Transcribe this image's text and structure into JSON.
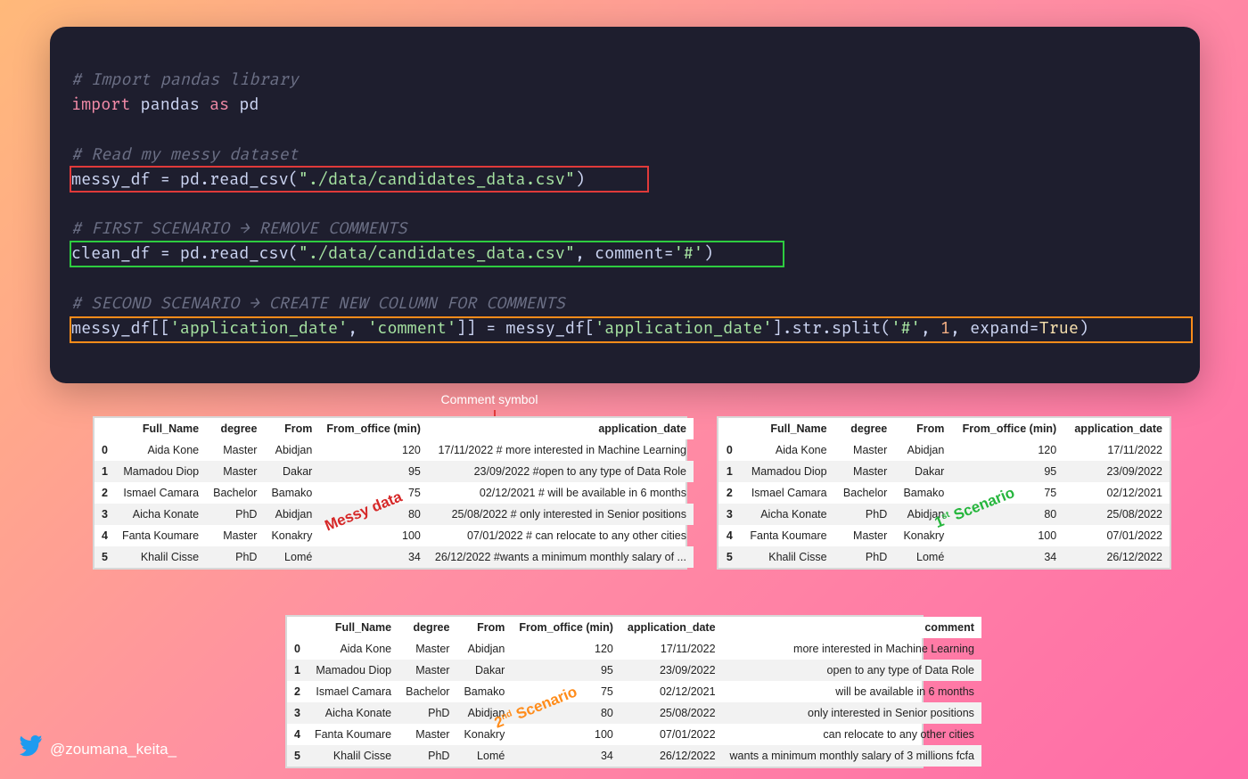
{
  "code": {
    "c1": "# Import pandas library",
    "c2": "# Read my messy dataset",
    "c3": "# FIRST SCENARIO → REMOVE COMMENTS",
    "c4": "# SECOND SCENARIO → CREATE NEW COLUMN FOR COMMENTS",
    "kw_import": "import",
    "pandas": "pandas",
    "kw_as": "as",
    "pd": "pd",
    "l3_a": "messy_df = pd.read_csv(",
    "l3_s": "\"./data/candidates_data.csv\"",
    "l3_b": ")",
    "l5_a": "clean_df = pd.read_csv(",
    "l5_s1": "\"./data/candidates_data.csv\"",
    "l5_m": ", comment=",
    "l5_s2": "'#'",
    "l5_b": ")",
    "l7_a": "messy_df[[",
    "l7_s1": "'application_date'",
    "l7_m1": ", ",
    "l7_s2": "'comment'",
    "l7_m2": "]] = messy_df[",
    "l7_s3": "'application_date'",
    "l7_m3": "].str.split(",
    "l7_s4": "'#'",
    "l7_m4": ", ",
    "l7_n": "1",
    "l7_m5": ", expand=",
    "l7_t": "True",
    "l7_b": ")"
  },
  "annot": {
    "comment_symbol": "Comment symbol",
    "messy": "Messy data",
    "s1a": "1",
    "s1b": "st",
    "s1c": " Scenario",
    "s2a": "2",
    "s2b": "nd",
    "s2c": " Scenario"
  },
  "tables": {
    "headers_messy": [
      "",
      "Full_Name",
      "degree",
      "From",
      "From_office (min)",
      "application_date"
    ],
    "headers_clean": [
      "",
      "Full_Name",
      "degree",
      "From",
      "From_office (min)",
      "application_date"
    ],
    "headers_split": [
      "",
      "Full_Name",
      "degree",
      "From",
      "From_office (min)",
      "application_date",
      "comment"
    ],
    "messy_rows": [
      [
        "0",
        "Aida Kone",
        "Master",
        "Abidjan",
        "120",
        "17/11/2022 # more interested in Machine Learning"
      ],
      [
        "1",
        "Mamadou Diop",
        "Master",
        "Dakar",
        "95",
        "23/09/2022 #open to any type of Data Role"
      ],
      [
        "2",
        "Ismael Camara",
        "Bachelor",
        "Bamako",
        "75",
        "02/12/2021 # will be available in 6 months"
      ],
      [
        "3",
        "Aicha Konate",
        "PhD",
        "Abidjan",
        "80",
        "25/08/2022 # only interested in Senior positions"
      ],
      [
        "4",
        "Fanta Koumare",
        "Master",
        "Konakry",
        "100",
        "07/01/2022 # can relocate to any other cities"
      ],
      [
        "5",
        "Khalil Cisse",
        "PhD",
        "Lomé",
        "34",
        "26/12/2022 #wants a minimum monthly salary of ..."
      ]
    ],
    "clean_rows": [
      [
        "0",
        "Aida Kone",
        "Master",
        "Abidjan",
        "120",
        "17/11/2022"
      ],
      [
        "1",
        "Mamadou Diop",
        "Master",
        "Dakar",
        "95",
        "23/09/2022"
      ],
      [
        "2",
        "Ismael Camara",
        "Bachelor",
        "Bamako",
        "75",
        "02/12/2021"
      ],
      [
        "3",
        "Aicha Konate",
        "PhD",
        "Abidjan",
        "80",
        "25/08/2022"
      ],
      [
        "4",
        "Fanta Koumare",
        "Master",
        "Konakry",
        "100",
        "07/01/2022"
      ],
      [
        "5",
        "Khalil Cisse",
        "PhD",
        "Lomé",
        "34",
        "26/12/2022"
      ]
    ],
    "split_rows": [
      [
        "0",
        "Aida Kone",
        "Master",
        "Abidjan",
        "120",
        "17/11/2022",
        "more interested in Machine Learning"
      ],
      [
        "1",
        "Mamadou Diop",
        "Master",
        "Dakar",
        "95",
        "23/09/2022",
        "open to any type of Data Role"
      ],
      [
        "2",
        "Ismael Camara",
        "Bachelor",
        "Bamako",
        "75",
        "02/12/2021",
        "will be available in 6 months"
      ],
      [
        "3",
        "Aicha Konate",
        "PhD",
        "Abidjan",
        "80",
        "25/08/2022",
        "only interested in Senior positions"
      ],
      [
        "4",
        "Fanta Koumare",
        "Master",
        "Konakry",
        "100",
        "07/01/2022",
        "can relocate to any other cities"
      ],
      [
        "5",
        "Khalil Cisse",
        "PhD",
        "Lomé",
        "34",
        "26/12/2022",
        "wants a minimum monthly salary of 3 millions fcfa"
      ]
    ]
  },
  "footer": {
    "handle": "@zoumana_keita_"
  }
}
